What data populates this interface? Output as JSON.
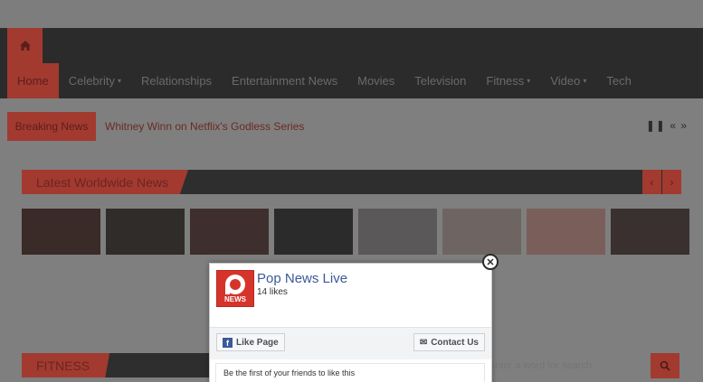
{
  "nav": {
    "items": [
      {
        "label": "Home",
        "active": true,
        "dropdown": false
      },
      {
        "label": "Celebrity",
        "active": false,
        "dropdown": true
      },
      {
        "label": "Relationships",
        "active": false,
        "dropdown": false
      },
      {
        "label": "Entertainment News",
        "active": false,
        "dropdown": false
      },
      {
        "label": "Movies",
        "active": false,
        "dropdown": false
      },
      {
        "label": "Television",
        "active": false,
        "dropdown": false
      },
      {
        "label": "Fitness",
        "active": false,
        "dropdown": true
      },
      {
        "label": "Video",
        "active": false,
        "dropdown": true
      },
      {
        "label": "Tech",
        "active": false,
        "dropdown": false
      }
    ]
  },
  "breaking": {
    "label": "Breaking News",
    "headline": "Whitney Winn on Netflix's Godless Series",
    "controls": "❚❚ « »"
  },
  "latest": {
    "title": "Latest Worldwide News",
    "prev": "‹",
    "next": "›"
  },
  "thumbs": [
    "#3a2a28",
    "#2f2c2a",
    "#3e2f2e",
    "#2b2b2b",
    "#5a5858",
    "#6e6563",
    "#7a5e5a",
    "#3a3030"
  ],
  "fitness": {
    "title": "FITNESS"
  },
  "search": {
    "placeholder": "enter a word for search"
  },
  "popup": {
    "page_name": "Pop News Live",
    "likes": "14 likes",
    "like_button": "Like Page",
    "contact_button": "Contact Us",
    "friends_text": "Be the first of your friends to like this",
    "friend_colors": [
      "#d9a07a",
      "#3a6fb5",
      "#a8c4e0",
      "#c0a890",
      "#5a5a5a",
      "#7aa0c0",
      "#2a2a2a",
      "#8a7060",
      "#c8b8a8",
      "#4a4a4a",
      "#b0b0b0",
      "#605048"
    ]
  },
  "colors": {
    "accent": "#a23a30",
    "nav_bg": "#2b2b2b",
    "fb_blue": "#3b5998"
  }
}
